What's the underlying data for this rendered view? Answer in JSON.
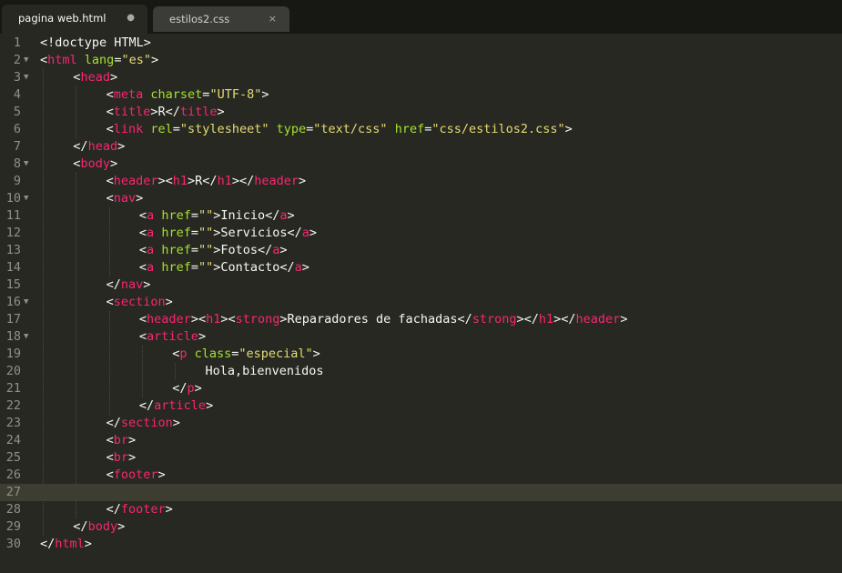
{
  "tabs": [
    {
      "label": "pagina web.html",
      "active": true,
      "control": "●"
    },
    {
      "label": "estilos2.css",
      "active": false,
      "control": "×"
    }
  ],
  "colors": {
    "background": "#272822",
    "tag": "#f92672",
    "attribute": "#a6e22e",
    "string": "#e6db74",
    "text": "#f8f8f2"
  },
  "editor": {
    "current_line": 27,
    "lines": [
      {
        "n": "1",
        "fold": false,
        "indent": 0,
        "tokens": [
          [
            "p",
            "<!doctype HTML>"
          ]
        ]
      },
      {
        "n": "2",
        "fold": true,
        "indent": 0,
        "tokens": [
          [
            "p",
            "<"
          ],
          [
            "t",
            "html"
          ],
          [
            "p",
            " "
          ],
          [
            "a",
            "lang"
          ],
          [
            "p",
            "="
          ],
          [
            "s",
            "\"es\""
          ],
          [
            "p",
            ">"
          ]
        ]
      },
      {
        "n": "3",
        "fold": true,
        "indent": 1,
        "tokens": [
          [
            "p",
            "<"
          ],
          [
            "t",
            "head"
          ],
          [
            "p",
            ">"
          ]
        ]
      },
      {
        "n": "4",
        "fold": false,
        "indent": 2,
        "tokens": [
          [
            "p",
            "<"
          ],
          [
            "t",
            "meta"
          ],
          [
            "p",
            " "
          ],
          [
            "a",
            "charset"
          ],
          [
            "p",
            "="
          ],
          [
            "s",
            "\"UTF-8\""
          ],
          [
            "p",
            ">"
          ]
        ]
      },
      {
        "n": "5",
        "fold": false,
        "indent": 2,
        "tokens": [
          [
            "p",
            "<"
          ],
          [
            "t",
            "title"
          ],
          [
            "p",
            ">R</"
          ],
          [
            "t",
            "title"
          ],
          [
            "p",
            ">"
          ]
        ]
      },
      {
        "n": "6",
        "fold": false,
        "indent": 2,
        "tokens": [
          [
            "p",
            "<"
          ],
          [
            "t",
            "link"
          ],
          [
            "p",
            " "
          ],
          [
            "a",
            "rel"
          ],
          [
            "p",
            "="
          ],
          [
            "s",
            "\"stylesheet\""
          ],
          [
            "p",
            " "
          ],
          [
            "a",
            "type"
          ],
          [
            "p",
            "="
          ],
          [
            "s",
            "\"text/css\""
          ],
          [
            "p",
            " "
          ],
          [
            "a",
            "href"
          ],
          [
            "p",
            "="
          ],
          [
            "s",
            "\"css/estilos2.css\""
          ],
          [
            "p",
            ">"
          ]
        ]
      },
      {
        "n": "7",
        "fold": false,
        "indent": 1,
        "tokens": [
          [
            "p",
            "</"
          ],
          [
            "t",
            "head"
          ],
          [
            "p",
            ">"
          ]
        ]
      },
      {
        "n": "8",
        "fold": true,
        "indent": 1,
        "tokens": [
          [
            "p",
            "<"
          ],
          [
            "t",
            "body"
          ],
          [
            "p",
            ">"
          ]
        ]
      },
      {
        "n": "9",
        "fold": false,
        "indent": 2,
        "tokens": [
          [
            "p",
            "<"
          ],
          [
            "t",
            "header"
          ],
          [
            "p",
            "><"
          ],
          [
            "t",
            "h1"
          ],
          [
            "p",
            ">R</"
          ],
          [
            "t",
            "h1"
          ],
          [
            "p",
            "></"
          ],
          [
            "t",
            "header"
          ],
          [
            "p",
            ">"
          ]
        ]
      },
      {
        "n": "10",
        "fold": true,
        "indent": 2,
        "tokens": [
          [
            "p",
            "<"
          ],
          [
            "t",
            "nav"
          ],
          [
            "p",
            ">"
          ]
        ]
      },
      {
        "n": "11",
        "fold": false,
        "indent": 3,
        "tokens": [
          [
            "p",
            "<"
          ],
          [
            "t",
            "a"
          ],
          [
            "p",
            " "
          ],
          [
            "a",
            "href"
          ],
          [
            "p",
            "="
          ],
          [
            "s",
            "\"\""
          ],
          [
            "p",
            ">Inicio</"
          ],
          [
            "t",
            "a"
          ],
          [
            "p",
            ">"
          ]
        ]
      },
      {
        "n": "12",
        "fold": false,
        "indent": 3,
        "tokens": [
          [
            "p",
            "<"
          ],
          [
            "t",
            "a"
          ],
          [
            "p",
            " "
          ],
          [
            "a",
            "href"
          ],
          [
            "p",
            "="
          ],
          [
            "s",
            "\"\""
          ],
          [
            "p",
            ">Servicios</"
          ],
          [
            "t",
            "a"
          ],
          [
            "p",
            ">"
          ]
        ]
      },
      {
        "n": "13",
        "fold": false,
        "indent": 3,
        "tokens": [
          [
            "p",
            "<"
          ],
          [
            "t",
            "a"
          ],
          [
            "p",
            " "
          ],
          [
            "a",
            "href"
          ],
          [
            "p",
            "="
          ],
          [
            "s",
            "\"\""
          ],
          [
            "p",
            ">Fotos</"
          ],
          [
            "t",
            "a"
          ],
          [
            "p",
            ">"
          ]
        ]
      },
      {
        "n": "14",
        "fold": false,
        "indent": 3,
        "tokens": [
          [
            "p",
            "<"
          ],
          [
            "t",
            "a"
          ],
          [
            "p",
            " "
          ],
          [
            "a",
            "href"
          ],
          [
            "p",
            "="
          ],
          [
            "s",
            "\"\""
          ],
          [
            "p",
            ">Contacto</"
          ],
          [
            "t",
            "a"
          ],
          [
            "p",
            ">"
          ]
        ]
      },
      {
        "n": "15",
        "fold": false,
        "indent": 2,
        "tokens": [
          [
            "p",
            "</"
          ],
          [
            "t",
            "nav"
          ],
          [
            "p",
            ">"
          ]
        ]
      },
      {
        "n": "16",
        "fold": true,
        "indent": 2,
        "tokens": [
          [
            "p",
            "<"
          ],
          [
            "t",
            "section"
          ],
          [
            "p",
            ">"
          ]
        ]
      },
      {
        "n": "17",
        "fold": false,
        "indent": 3,
        "tokens": [
          [
            "p",
            "<"
          ],
          [
            "t",
            "header"
          ],
          [
            "p",
            "><"
          ],
          [
            "t",
            "h1"
          ],
          [
            "p",
            "><"
          ],
          [
            "t",
            "strong"
          ],
          [
            "p",
            ">Reparadores de fachadas</"
          ],
          [
            "t",
            "strong"
          ],
          [
            "p",
            "></"
          ],
          [
            "t",
            "h1"
          ],
          [
            "p",
            "></"
          ],
          [
            "t",
            "header"
          ],
          [
            "p",
            ">"
          ]
        ]
      },
      {
        "n": "18",
        "fold": true,
        "indent": 3,
        "tokens": [
          [
            "p",
            "<"
          ],
          [
            "t",
            "article"
          ],
          [
            "p",
            ">"
          ]
        ]
      },
      {
        "n": "19",
        "fold": false,
        "indent": 4,
        "tokens": [
          [
            "p",
            "<"
          ],
          [
            "t",
            "p"
          ],
          [
            "p",
            " "
          ],
          [
            "a",
            "class"
          ],
          [
            "p",
            "="
          ],
          [
            "s",
            "\"especial\""
          ],
          [
            "p",
            ">"
          ]
        ]
      },
      {
        "n": "20",
        "fold": false,
        "indent": 5,
        "tokens": [
          [
            "p",
            "Hola,bienvenidos"
          ]
        ]
      },
      {
        "n": "21",
        "fold": false,
        "indent": 4,
        "tokens": [
          [
            "p",
            "</"
          ],
          [
            "t",
            "p"
          ],
          [
            "p",
            ">"
          ]
        ]
      },
      {
        "n": "22",
        "fold": false,
        "indent": 3,
        "tokens": [
          [
            "p",
            "</"
          ],
          [
            "t",
            "article"
          ],
          [
            "p",
            ">"
          ]
        ]
      },
      {
        "n": "23",
        "fold": false,
        "indent": 2,
        "tokens": [
          [
            "p",
            "</"
          ],
          [
            "t",
            "section"
          ],
          [
            "p",
            ">"
          ]
        ]
      },
      {
        "n": "24",
        "fold": false,
        "indent": 2,
        "tokens": [
          [
            "p",
            "<"
          ],
          [
            "t",
            "br"
          ],
          [
            "p",
            ">"
          ]
        ]
      },
      {
        "n": "25",
        "fold": false,
        "indent": 2,
        "tokens": [
          [
            "p",
            "<"
          ],
          [
            "t",
            "br"
          ],
          [
            "p",
            ">"
          ]
        ]
      },
      {
        "n": "26",
        "fold": false,
        "indent": 2,
        "tokens": [
          [
            "p",
            "<"
          ],
          [
            "t",
            "footer"
          ],
          [
            "p",
            ">"
          ]
        ]
      },
      {
        "n": "27",
        "fold": false,
        "indent": 0,
        "tokens": []
      },
      {
        "n": "28",
        "fold": false,
        "indent": 2,
        "tokens": [
          [
            "p",
            "</"
          ],
          [
            "t",
            "footer"
          ],
          [
            "p",
            ">"
          ]
        ]
      },
      {
        "n": "29",
        "fold": false,
        "indent": 1,
        "tokens": [
          [
            "p",
            "</"
          ],
          [
            "t",
            "body"
          ],
          [
            "p",
            ">"
          ]
        ]
      },
      {
        "n": "30",
        "fold": false,
        "indent": 0,
        "tokens": [
          [
            "p",
            "</"
          ],
          [
            "t",
            "html"
          ],
          [
            "p",
            ">"
          ]
        ]
      }
    ]
  }
}
